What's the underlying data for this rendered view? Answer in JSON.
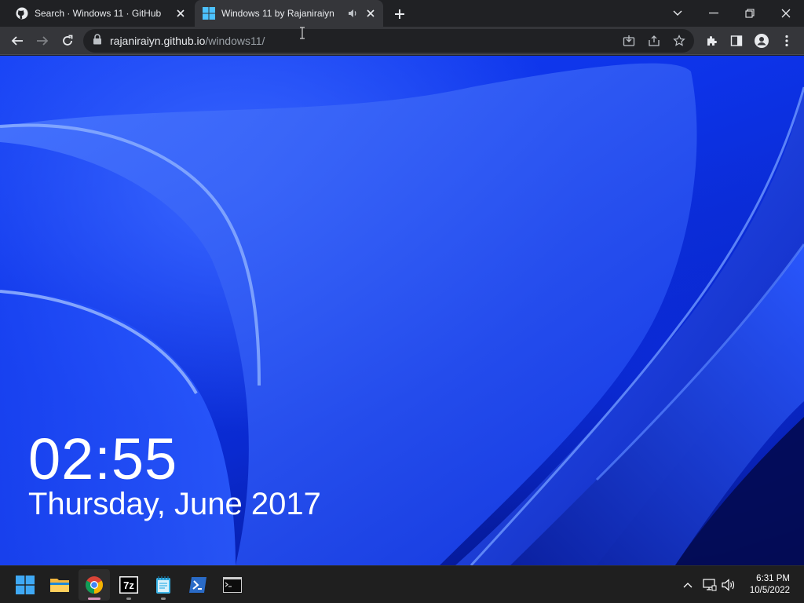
{
  "tabs": [
    {
      "title": "Search · Windows 11 · GitHub",
      "favicon": "github-icon"
    },
    {
      "title": "Windows 11 by Rajaniraiyn",
      "favicon": "windows-logo-icon",
      "active": true,
      "audio": true
    }
  ],
  "address_bar": {
    "host": "rajaniraiyn.github.io",
    "path": "/windows11/"
  },
  "lockscreen": {
    "time": "02:55",
    "date": "Thursday, June 2017"
  },
  "taskbar": {
    "apps": [
      "start-button",
      "file-explorer",
      "chrome",
      "7zip",
      "notepad",
      "powershell",
      "terminal"
    ],
    "clock_time": "6:31 PM",
    "clock_date": "10/5/2022"
  },
  "colors": {
    "tabstrip": "#202124",
    "toolbar": "#35363a",
    "wallpaper_accent": "#1540f5",
    "taskbar": "#1f1f1f"
  }
}
